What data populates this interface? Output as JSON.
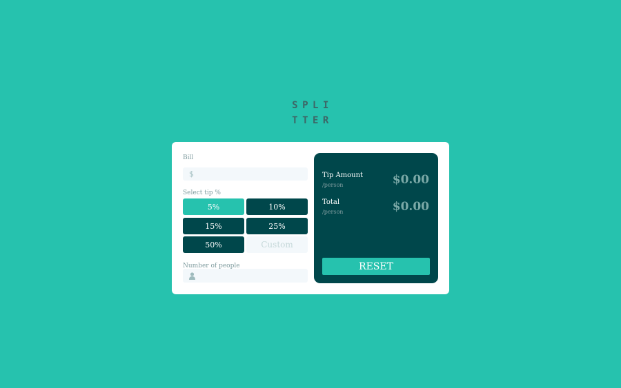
{
  "logo": {
    "line1": "SPLI",
    "line2": "TTER"
  },
  "bill": {
    "label": "Bill",
    "currency_symbol": "$",
    "value": ""
  },
  "tip": {
    "label": "Select tip %",
    "options": [
      "5%",
      "10%",
      "15%",
      "25%",
      "50%"
    ],
    "selected": "5%",
    "custom_placeholder": "Custom"
  },
  "people": {
    "label": "Number of people",
    "value": ""
  },
  "results": {
    "tip_amount": {
      "title": "Tip Amount",
      "sub": "/person",
      "value": "$0.00"
    },
    "total": {
      "title": "Total",
      "sub": "/person",
      "value": "$0.00"
    },
    "reset_label": "RESET"
  },
  "colors": {
    "background": "#26c2ae",
    "dark_cyan": "#00474b",
    "accent": "#26c2ae",
    "field_bg": "#f3f8fb"
  }
}
